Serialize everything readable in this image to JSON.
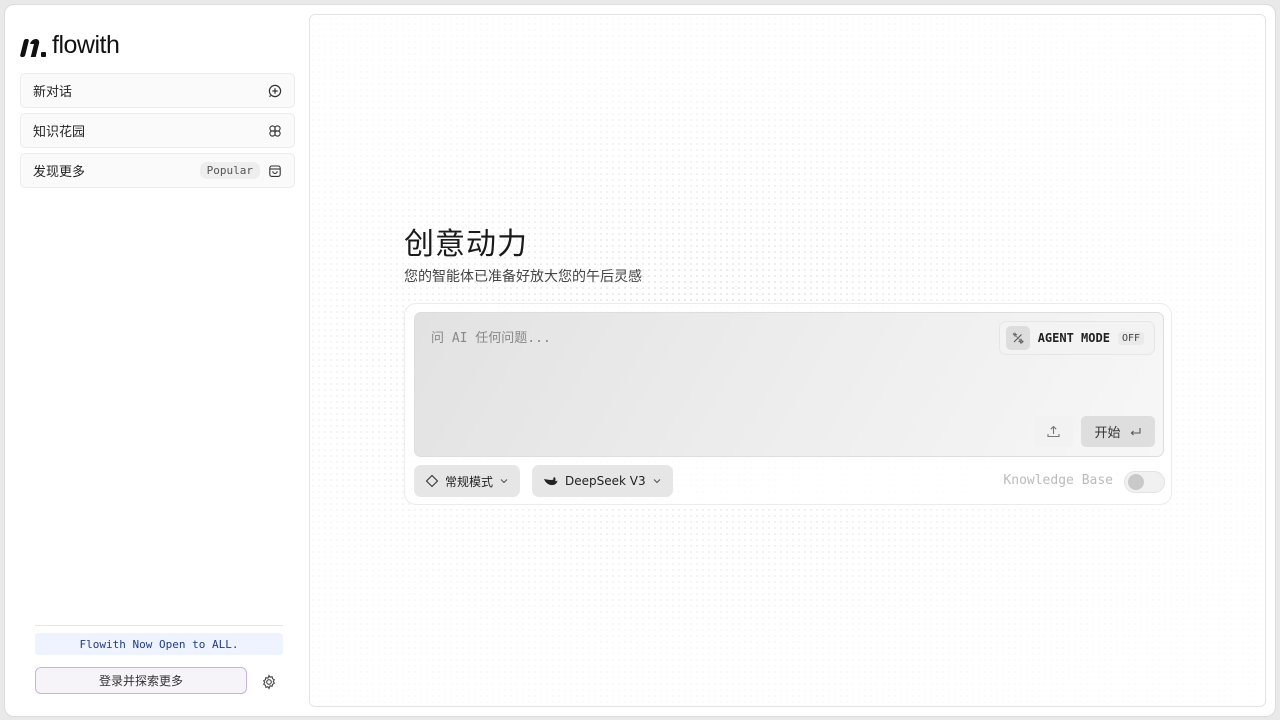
{
  "app": {
    "name": "flowith"
  },
  "sidebar": {
    "items": [
      {
        "label": "新对话",
        "icon": "new-chat-icon"
      },
      {
        "label": "知识花园",
        "icon": "garden-icon"
      },
      {
        "label": "发现更多",
        "badge": "Popular",
        "icon": "bag-icon"
      }
    ],
    "announcement": "Flowith Now Open to ALL.",
    "login_label": "登录并探索更多",
    "settings_icon": "gear-icon"
  },
  "main": {
    "title": "创意动力",
    "subtitle": "您的智能体已准备好放大您的午后灵感",
    "composer": {
      "placeholder": "问 AI 任何问题...",
      "agent_mode_label": "AGENT MODE",
      "agent_mode_state": "OFF",
      "start_label": "开始"
    },
    "mode_select": {
      "label": "常规模式"
    },
    "model_select": {
      "label": "DeepSeek V3"
    },
    "knowledge_base": {
      "label": "Knowledge Base",
      "enabled": false
    }
  },
  "colors": {
    "accent_border": "#c9b3e6",
    "announce_bg": "#eef3ff",
    "announce_text": "#1f3b86"
  }
}
